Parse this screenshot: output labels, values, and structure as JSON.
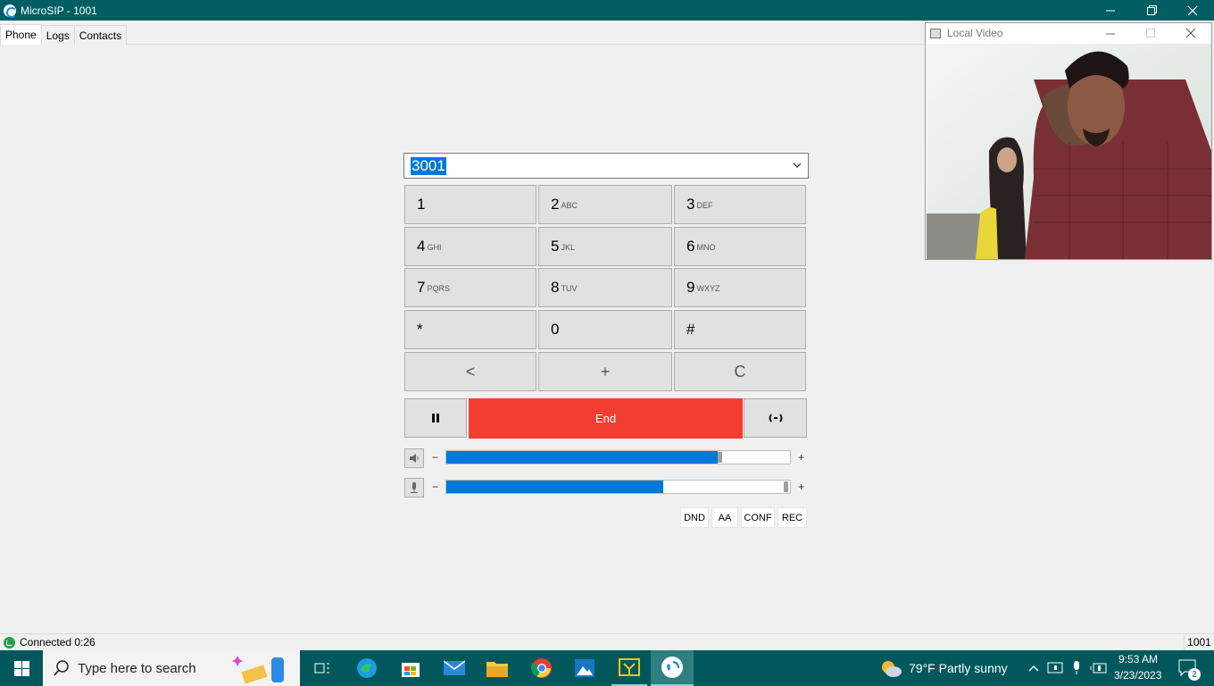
{
  "window": {
    "title": "MicroSIP - 1001"
  },
  "tabs": [
    {
      "label": "Phone"
    },
    {
      "label": "Logs"
    },
    {
      "label": "Contacts"
    }
  ],
  "dial": {
    "number": "3001"
  },
  "keypad": [
    {
      "digit": "1",
      "letters": ""
    },
    {
      "digit": "2",
      "letters": "ABC"
    },
    {
      "digit": "3",
      "letters": "DEF"
    },
    {
      "digit": "4",
      "letters": "GHI"
    },
    {
      "digit": "5",
      "letters": "JKL"
    },
    {
      "digit": "6",
      "letters": "MNO"
    },
    {
      "digit": "7",
      "letters": "PQRS"
    },
    {
      "digit": "8",
      "letters": "TUV"
    },
    {
      "digit": "9",
      "letters": "WXYZ"
    },
    {
      "digit": "*",
      "letters": ""
    },
    {
      "digit": "0",
      "letters": ""
    },
    {
      "digit": "#",
      "letters": ""
    }
  ],
  "edit_keys": {
    "backspace": "<",
    "plus": "+",
    "clear": "C"
  },
  "call": {
    "end_label": "End",
    "hold_icon": "pause-icon",
    "transfer_icon": "transfer-icon",
    "end_color": "#f33d31"
  },
  "volume": {
    "minus": "−",
    "plus": "+",
    "speaker_level": 0.79,
    "mic_level": 0.63,
    "accent": "#0078d7"
  },
  "toggles": {
    "dnd": "DND",
    "aa": "AA",
    "conf": "CONF",
    "rec": "REC"
  },
  "status": {
    "text": "Connected 0:26",
    "account": "1001"
  },
  "video_window": {
    "title": "Local Video"
  },
  "taskbar": {
    "search_placeholder": "Type here to search",
    "weather": "79°F  Partly sunny",
    "time": "9:53 AM",
    "date": "3/23/2023",
    "notifications": "2"
  }
}
